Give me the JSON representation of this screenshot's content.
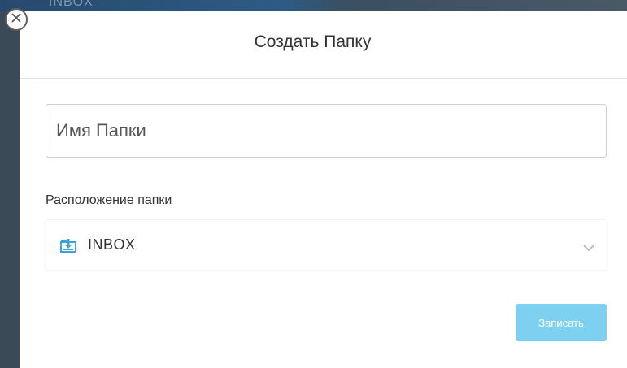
{
  "background": {
    "text": "INBOX"
  },
  "modal": {
    "title": "Создать Папку",
    "name_input": {
      "placeholder": "Имя Папки",
      "value": ""
    },
    "location_label": "Расположение папки",
    "location_select": {
      "selected": "INBOX",
      "icon": "folder-inbox-icon"
    },
    "save_label": "Записать",
    "close_icon": "close-circle-icon"
  },
  "colors": {
    "save_button": "#7ed0f0",
    "inbox_icon": "#3ea3d6",
    "backdrop": "#3b4a57"
  }
}
